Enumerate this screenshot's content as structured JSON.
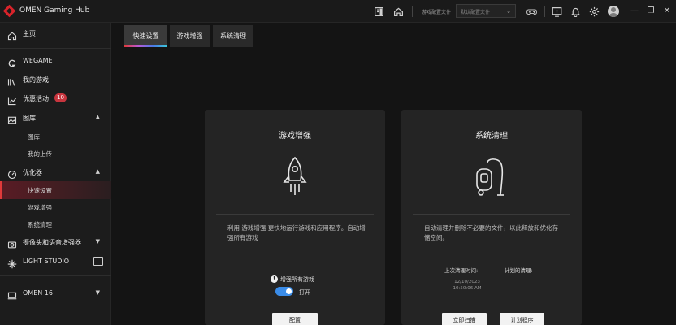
{
  "app": {
    "title": "OMEN Gaming Hub"
  },
  "titlebar": {
    "profile_label": "游戏配置文件",
    "profile_placeholder": "默认配置文件",
    "minimize": "—",
    "restore": "❐",
    "close": "✕"
  },
  "sidebar": {
    "home": "主页",
    "wegame": "WEGAME",
    "my_games": "我的游戏",
    "offers": "优惠活动",
    "offers_badge": "10",
    "gallery": "图库",
    "gallery_library": "图库",
    "gallery_uploads": "我的上传",
    "optimizer": "优化器",
    "quick_settings": "快速设置",
    "game_boost": "游戏增强",
    "system_cleanup": "系统清理",
    "camera_mic": "摄像头和语音增强器",
    "light_studio": "LIGHT STUDIO",
    "device": "OMEN 16"
  },
  "tabs": [
    {
      "label": "快速设置"
    },
    {
      "label": "游戏增强"
    },
    {
      "label": "系统清理"
    }
  ],
  "boost_card": {
    "title": "游戏增强",
    "description": "利用 游戏增强 更快地运行游戏和应用程序。自动增强所有游戏",
    "toggle_title": "增强所有游戏",
    "toggle_state": "打开",
    "config_button": "配置"
  },
  "cleanup_card": {
    "title": "系统清理",
    "description": "自动清理并删除不必要的文件，以此释放和优化存储空间。",
    "last_cleanup_label": "上次清理时间:",
    "last_cleanup_date": "12/10/2023",
    "last_cleanup_time": "10:50:06 AM",
    "scheduled_label": "计划的清理:",
    "scheduled_value": "-",
    "scan_button": "立即扫描",
    "schedule_button": "计划程序"
  },
  "colors": {
    "accent_red": "#e03a3a",
    "toggle_blue": "#3a8ce8",
    "badge_red": "#c8353e"
  }
}
